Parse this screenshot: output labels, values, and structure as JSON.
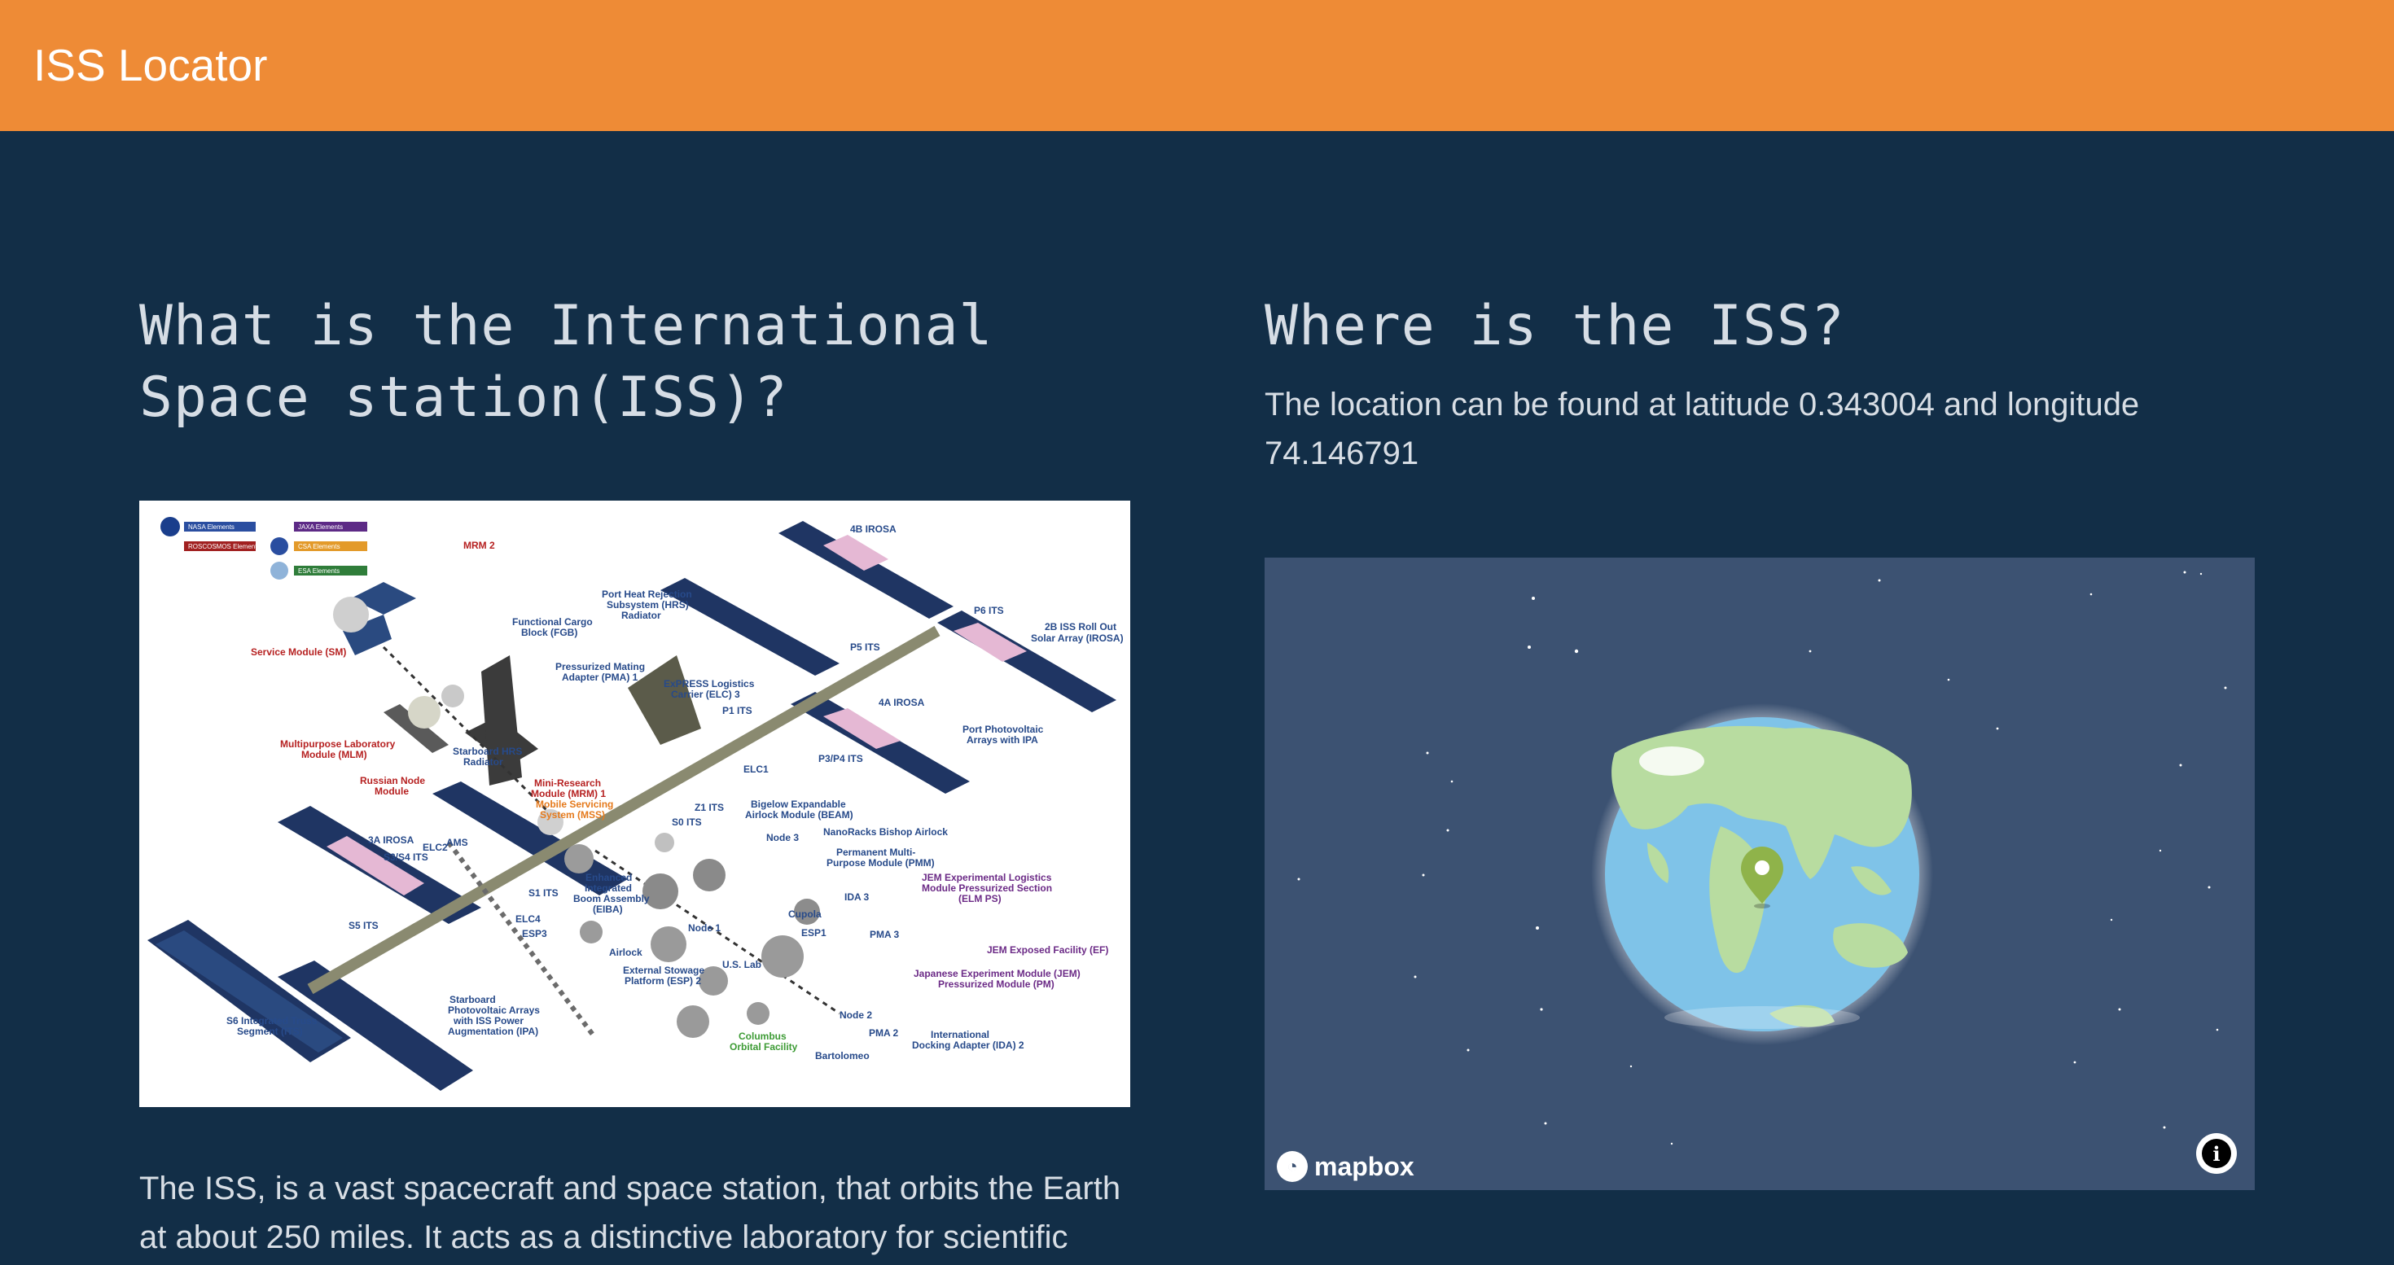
{
  "header": {
    "brand": "ISS Locator"
  },
  "about": {
    "title": "What is the International Space station(ISS)?",
    "body": "The ISS, is a vast spacecraft and space station, that orbits the Earth at about 250 miles. It acts as a distinctive laboratory for scientific",
    "diagram": {
      "legend": [
        "NASA Elements",
        "ROSCOSMOS Elements",
        "JAXA Elements",
        "CSA Elements",
        "ESA Elements"
      ],
      "labels": [
        {
          "text": "4B IROSA",
          "color": "blue"
        },
        {
          "text": "MRM 2",
          "color": "red"
        },
        {
          "text": "P6 ITS",
          "color": "blue"
        },
        {
          "text": "2B ISS Roll Out",
          "color": "blue"
        },
        {
          "text": "Solar Array (IROSA)",
          "color": "blue"
        },
        {
          "text": "Port Heat Rejection",
          "color": "blue"
        },
        {
          "text": "Subsystem (HRS)",
          "color": "blue"
        },
        {
          "text": "Radiator",
          "color": "blue"
        },
        {
          "text": "Functional Cargo",
          "color": "blue"
        },
        {
          "text": "Block (FGB)",
          "color": "blue"
        },
        {
          "text": "Service Module (SM)",
          "color": "red"
        },
        {
          "text": "P5 ITS",
          "color": "blue"
        },
        {
          "text": "Pressurized Mating",
          "color": "blue"
        },
        {
          "text": "Adapter (PMA) 1",
          "color": "blue"
        },
        {
          "text": "ExPRESS Logistics",
          "color": "blue"
        },
        {
          "text": "Carrier (ELC) 3",
          "color": "blue"
        },
        {
          "text": "4A IROSA",
          "color": "blue"
        },
        {
          "text": "P1 ITS",
          "color": "blue"
        },
        {
          "text": "Port Photovoltaic",
          "color": "blue"
        },
        {
          "text": "Arrays with IPA",
          "color": "blue"
        },
        {
          "text": "Multipurpose Laboratory",
          "color": "red"
        },
        {
          "text": "Module (MLM)",
          "color": "red"
        },
        {
          "text": "Starboard HRS",
          "color": "blue"
        },
        {
          "text": "Radiator",
          "color": "blue"
        },
        {
          "text": "P3/P4 ITS",
          "color": "blue"
        },
        {
          "text": "Russian Node",
          "color": "red"
        },
        {
          "text": "Module",
          "color": "red"
        },
        {
          "text": "Mini-Research",
          "color": "red"
        },
        {
          "text": "Module (MRM) 1",
          "color": "red"
        },
        {
          "text": "ELC1",
          "color": "blue"
        },
        {
          "text": "Mobile Servicing",
          "color": "orange"
        },
        {
          "text": "System (MSS)",
          "color": "orange"
        },
        {
          "text": "Z1 ITS",
          "color": "blue"
        },
        {
          "text": "Bigelow Expandable",
          "color": "blue"
        },
        {
          "text": "Airlock Module (BEAM)",
          "color": "blue"
        },
        {
          "text": "S0 ITS",
          "color": "blue"
        },
        {
          "text": "NanoRacks Bishop Airlock",
          "color": "blue"
        },
        {
          "text": "3A IROSA",
          "color": "blue"
        },
        {
          "text": "ELC2",
          "color": "blue"
        },
        {
          "text": "AMS",
          "color": "blue"
        },
        {
          "text": "Node 3",
          "color": "blue"
        },
        {
          "text": "Permanent Multi-",
          "color": "blue"
        },
        {
          "text": "Purpose Module (PMM)",
          "color": "blue"
        },
        {
          "text": "S3/S4 ITS",
          "color": "blue"
        },
        {
          "text": "Enhanced",
          "color": "blue"
        },
        {
          "text": "Integrated",
          "color": "blue"
        },
        {
          "text": "Boom Assembly",
          "color": "blue"
        },
        {
          "text": "(EIBA)",
          "color": "blue"
        },
        {
          "text": "JEM Experimental Logistics",
          "color": "purple"
        },
        {
          "text": "Module Pressurized Section",
          "color": "purple"
        },
        {
          "text": "(ELM PS)",
          "color": "purple"
        },
        {
          "text": "S1 ITS",
          "color": "blue"
        },
        {
          "text": "IDA 3",
          "color": "blue"
        },
        {
          "text": "ELC4",
          "color": "blue"
        },
        {
          "text": "Cupola",
          "color": "blue"
        },
        {
          "text": "S5 ITS",
          "color": "blue"
        },
        {
          "text": "ESP3",
          "color": "blue"
        },
        {
          "text": "Node 1",
          "color": "blue"
        },
        {
          "text": "ESP1",
          "color": "blue"
        },
        {
          "text": "PMA 3",
          "color": "blue"
        },
        {
          "text": "JEM Exposed Facility (EF)",
          "color": "purple"
        },
        {
          "text": "Airlock",
          "color": "blue"
        },
        {
          "text": "External Stowage",
          "color": "blue"
        },
        {
          "text": "Platform (ESP) 2",
          "color": "blue"
        },
        {
          "text": "U.S. Lab",
          "color": "blue"
        },
        {
          "text": "Japanese Experiment Module (JEM)",
          "color": "purple"
        },
        {
          "text": "Pressurized Module (PM)",
          "color": "purple"
        },
        {
          "text": "Starboard",
          "color": "blue"
        },
        {
          "text": "Photovoltaic Arrays",
          "color": "blue"
        },
        {
          "text": "with ISS Power",
          "color": "blue"
        },
        {
          "text": "Augmentation (IPA)",
          "color": "blue"
        },
        {
          "text": "S6 Integrated Truss",
          "color": "blue"
        },
        {
          "text": "Segment (ITS)",
          "color": "blue"
        },
        {
          "text": "Node 2",
          "color": "blue"
        },
        {
          "text": "PMA 2",
          "color": "blue"
        },
        {
          "text": "International",
          "color": "blue"
        },
        {
          "text": "Docking Adapter (IDA) 2",
          "color": "blue"
        },
        {
          "text": "Columbus",
          "color": "green"
        },
        {
          "text": "Orbital Facility",
          "color": "green"
        },
        {
          "text": "Bartolomeo",
          "color": "blue"
        }
      ]
    }
  },
  "location": {
    "title": "Where is the ISS?",
    "text": "The location can be found at latitude 0.343004 and longitude 74.146791",
    "map": {
      "attribution_logo": "mapbox",
      "marker": "location-pin-icon",
      "info_icon": "info-icon",
      "colors": {
        "space": "#3c5272",
        "ocean": "#7fc3e8",
        "land": "#b8dca0",
        "marker": "#8fb34a"
      }
    }
  }
}
